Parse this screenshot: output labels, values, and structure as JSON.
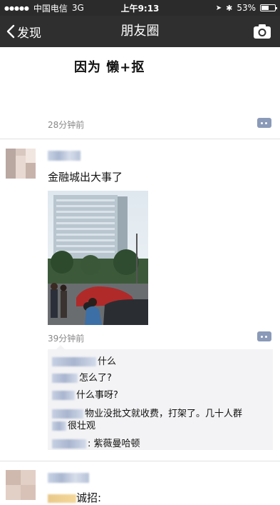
{
  "status_bar": {
    "signal": "●●●●●",
    "carrier": "中国电信",
    "network": "3G",
    "time": "上午9:13",
    "battery_percent": "53%",
    "battery_level": 0.53
  },
  "nav": {
    "back_label": "发现",
    "title": "朋友圈"
  },
  "post1": {
    "caption": "因为 懒+抠",
    "time": "28分钟前"
  },
  "post2": {
    "text": "金融城出大事了",
    "time": "39分钟前",
    "comments": [
      {
        "text": "什么"
      },
      {
        "text": "怎么了?"
      },
      {
        "text": "什么事呀?"
      },
      {
        "text": "物业没批文就收费，打架了。几十人群"
      },
      {
        "text": "很壮观"
      },
      {
        "text": ": 紫薇曼哈顿"
      }
    ]
  },
  "post3": {
    "text": "诚招:"
  },
  "colors": {
    "nav_bg": "#2f2f2f",
    "link_blue": "#8a9ab8",
    "comment_bg": "#f3f3f5"
  },
  "icons": {
    "back": "chevron-left-icon",
    "camera": "camera-icon",
    "comment": "comment-icon",
    "battery": "battery-icon"
  }
}
